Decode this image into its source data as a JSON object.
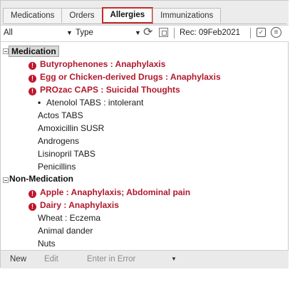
{
  "tabs": [
    {
      "label": "Medications",
      "active": false
    },
    {
      "label": "Orders",
      "active": false
    },
    {
      "label": "Allergies",
      "active": true
    },
    {
      "label": "Immunizations",
      "active": false
    }
  ],
  "filter": {
    "scope_value": "All",
    "type_value": "Type",
    "record_label": "Rec: 09Feb2021"
  },
  "icons": {
    "dropdown": "chevron-down-icon",
    "refresh": "refresh-icon",
    "tree": "tree-view-icon",
    "calendar": "calendar-check-icon",
    "list": "list-circle-icon",
    "alert": "alert-icon"
  },
  "groups": [
    {
      "label": "Medication",
      "selected": true,
      "items": [
        {
          "text": "Butyrophenones : Anaphylaxis",
          "severity": "severe"
        },
        {
          "text": "Egg or Chicken-derived Drugs : Anaphylaxis",
          "severity": "severe"
        },
        {
          "text": "PROzac CAPS : Suicidal Thoughts",
          "severity": "severe"
        },
        {
          "text": "Atenolol TABS : intolerant",
          "severity": "bullet"
        },
        {
          "text": "Actos TABS",
          "severity": "none"
        },
        {
          "text": "Amoxicillin SUSR",
          "severity": "none"
        },
        {
          "text": "Androgens",
          "severity": "none"
        },
        {
          "text": "Lisinopril TABS",
          "severity": "none"
        },
        {
          "text": "Penicillins",
          "severity": "none"
        }
      ]
    },
    {
      "label": "Non-Medication",
      "selected": false,
      "items": [
        {
          "text": "Apple : Anaphylaxis; Abdominal pain",
          "severity": "severe"
        },
        {
          "text": "Dairy : Anaphylaxis",
          "severity": "severe"
        },
        {
          "text": "Wheat : Eczema",
          "severity": "none"
        },
        {
          "text": "Animal dander",
          "severity": "none"
        },
        {
          "text": "Nuts",
          "severity": "none"
        }
      ]
    }
  ],
  "toolbar": {
    "new_label": "New",
    "edit_label": "Edit",
    "error_label": "Enter in Error"
  },
  "colors": {
    "severe_text": "#b0182b",
    "active_tab_border": "#c62b2b",
    "toolbar_bg": "#eaeaea"
  }
}
